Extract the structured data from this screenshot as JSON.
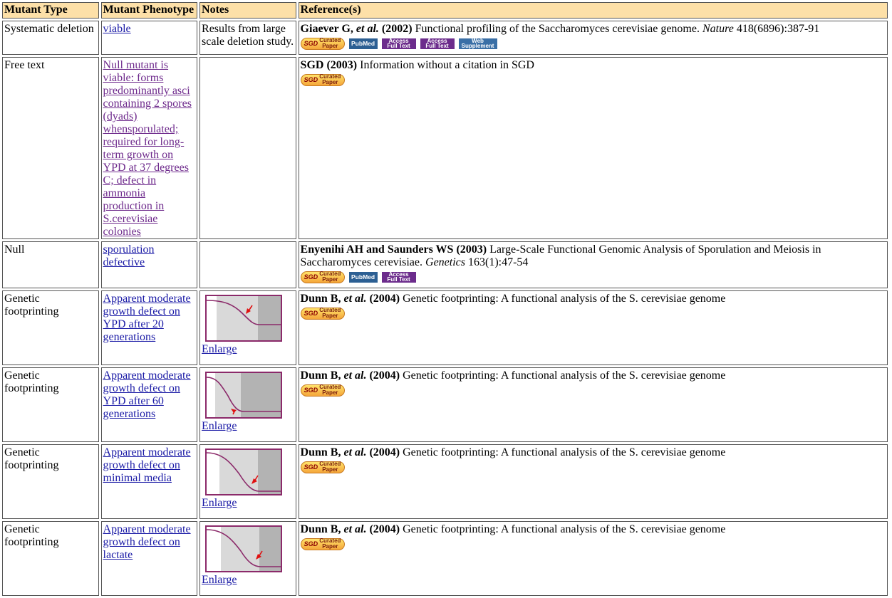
{
  "headers": [
    "Mutant Type",
    "Mutant Phenotype",
    "Notes",
    "Reference(s)"
  ],
  "badges": {
    "sgd_prefix": "SGD",
    "sgd_line1": "Curated",
    "sgd_line2": "Paper",
    "pubmed": "PubMed",
    "access_line1": "Access",
    "access_line2": "Full Text",
    "web_line1": "Web",
    "web_line2": "Supplement"
  },
  "enlarge_label": "Enlarge",
  "rows": [
    {
      "type": "Systematic deletion",
      "phenotype": "viable",
      "notes": "Results from large scale deletion study.",
      "ref_authors": "Giaever G, ",
      "ref_etal": "et al.",
      "ref_year": " (2002)",
      "ref_title": " Functional profiling of the Saccharomyces cerevisiae genome. ",
      "ref_journal": "Nature",
      "ref_cite": " 418(6896):387-91"
    },
    {
      "type": "Free text",
      "phenotype": "Null mutant is viable: forms predominantly asci containing 2 spores (dyads) whensporulated; required for long-term growth on YPD at 37 degrees C; defect in ammonia production in S.cerevisiae colonies",
      "notes": "",
      "ref_authors": "SGD (2003)",
      "ref_title": " Information without a citation in SGD"
    },
    {
      "type": "Null",
      "phenotype": "sporulation defective",
      "notes": "",
      "ref_authors": "Enyenihi AH and Saunders WS (2003)",
      "ref_title": " Large-Scale Functional Genomic Analysis of Sporulation and Meiosis in Saccharomyces cerevisiae. ",
      "ref_journal": "Genetics",
      "ref_cite": " 163(1):47-54"
    },
    {
      "type": "Genetic footprinting",
      "phenotype": "Apparent moderate growth defect on YPD after 20 generations",
      "ref_authors": "Dunn B, ",
      "ref_etal": "et al.",
      "ref_year": " (2004)",
      "ref_title": " Genetic footprinting: A functional analysis of the S. cerevisiae genome"
    },
    {
      "type": "Genetic footprinting",
      "phenotype": "Apparent moderate growth defect on YPD after 60 generations",
      "ref_authors": "Dunn B, ",
      "ref_etal": "et al.",
      "ref_year": " (2004)",
      "ref_title": " Genetic footprinting: A functional analysis of the S. cerevisiae genome"
    },
    {
      "type": "Genetic footprinting",
      "phenotype": "Apparent moderate growth defect on minimal media",
      "ref_authors": "Dunn B, ",
      "ref_etal": "et al.",
      "ref_year": " (2004)",
      "ref_title": " Genetic footprinting: A functional analysis of the S. cerevisiae genome"
    },
    {
      "type": "Genetic footprinting",
      "phenotype": "Apparent moderate growth defect on lactate",
      "ref_authors": "Dunn B, ",
      "ref_etal": "et al.",
      "ref_year": " (2004)",
      "ref_title": " Genetic footprinting: A functional analysis of the S. cerevisiae genome"
    }
  ],
  "colors": {
    "header_bg": "#fde0a8",
    "link": "#1a1aa6",
    "visited_link": "#6e2a8c",
    "thumb_border": "#8b2a6a",
    "thumb_arrow": "#e01010"
  }
}
